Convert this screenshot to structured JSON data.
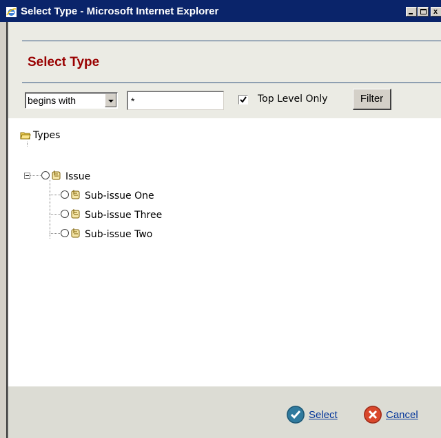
{
  "window": {
    "title": "Select Type - Microsoft Internet Explorer",
    "controls": [
      "minimize",
      "maximize",
      "close"
    ]
  },
  "header": {
    "title": "Select Type"
  },
  "filter_bar": {
    "match_mode": {
      "selected": "begins with"
    },
    "search_value": "*",
    "top_level_only": {
      "checked": true,
      "label": "Top Level Only"
    },
    "filter_label": "Filter"
  },
  "tree": {
    "root": {
      "label": "Types",
      "icon": "folder-open-icon"
    },
    "nodes": [
      {
        "label": "Issue",
        "level": 1,
        "expanded": true,
        "icon": "hand-item-icon"
      },
      {
        "label": "Sub-issue One",
        "level": 2,
        "icon": "hand-item-icon"
      },
      {
        "label": "Sub-issue Three",
        "level": 2,
        "icon": "hand-item-icon"
      },
      {
        "label": "Sub-issue Two",
        "level": 2,
        "icon": "hand-item-icon"
      }
    ]
  },
  "footer": {
    "select_label": "Select",
    "cancel_label": "Cancel"
  },
  "colors": {
    "title_bar": "#0a246a",
    "page_title": "#990000",
    "link": "#003399",
    "select_icon": "#2f7a9e",
    "cancel_icon": "#c0392b"
  }
}
